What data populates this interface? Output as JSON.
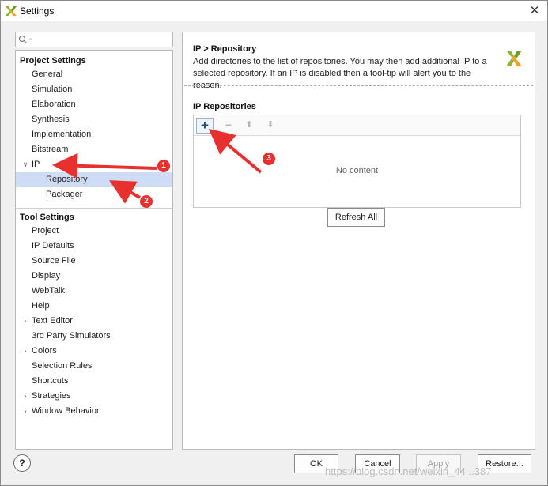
{
  "window": {
    "title": "Settings",
    "close_glyph": "✕",
    "icon": "xilinx-logo-icon"
  },
  "search": {
    "placeholder": "Q-",
    "icon": "search-icon"
  },
  "tree": {
    "project_settings_label": "Project Settings",
    "project_items": [
      {
        "label": "General"
      },
      {
        "label": "Simulation"
      },
      {
        "label": "Elaboration"
      },
      {
        "label": "Synthesis"
      },
      {
        "label": "Implementation"
      },
      {
        "label": "Bitstream"
      },
      {
        "label": "IP"
      },
      {
        "label": "Repository"
      },
      {
        "label": "Packager"
      }
    ],
    "tool_settings_label": "Tool Settings",
    "tool_items": [
      {
        "label": "Project"
      },
      {
        "label": "IP Defaults"
      },
      {
        "label": "Source File"
      },
      {
        "label": "Display"
      },
      {
        "label": "WebTalk"
      },
      {
        "label": "Help"
      },
      {
        "label": "Text Editor"
      },
      {
        "label": "3rd Party Simulators"
      },
      {
        "label": "Colors"
      },
      {
        "label": "Selection Rules"
      },
      {
        "label": "Shortcuts"
      },
      {
        "label": "Strategies"
      },
      {
        "label": "Window Behavior"
      }
    ],
    "expanded_glyph": "∨",
    "collapsed_glyph": "›"
  },
  "main": {
    "breadcrumb": "IP > Repository",
    "description": "Add directories to the list of repositories. You may then add additional IP to a selected repository. If an IP is disabled then a tool-tip will alert you to the reason.",
    "repositories_label": "IP Repositories",
    "toolbar": {
      "add_glyph": "+",
      "remove_glyph": "−",
      "move_up_glyph": "⬆",
      "move_down_glyph": "⬇"
    },
    "empty_text": "No content",
    "refresh_label": "Refresh All"
  },
  "footer": {
    "help_label": "?",
    "ok_label": "OK",
    "cancel_label": "Cancel",
    "apply_label": "Apply",
    "restore_label": "Restore..."
  },
  "annotations": {
    "badges": [
      "1",
      "2",
      "3"
    ],
    "color": "#e8312f"
  },
  "watermark": "https://blog.csdn.net/weixin_44...387",
  "colors": {
    "selection": "#cfdcf5",
    "accent": "#1c4a7a",
    "brand": "#8cb532"
  }
}
